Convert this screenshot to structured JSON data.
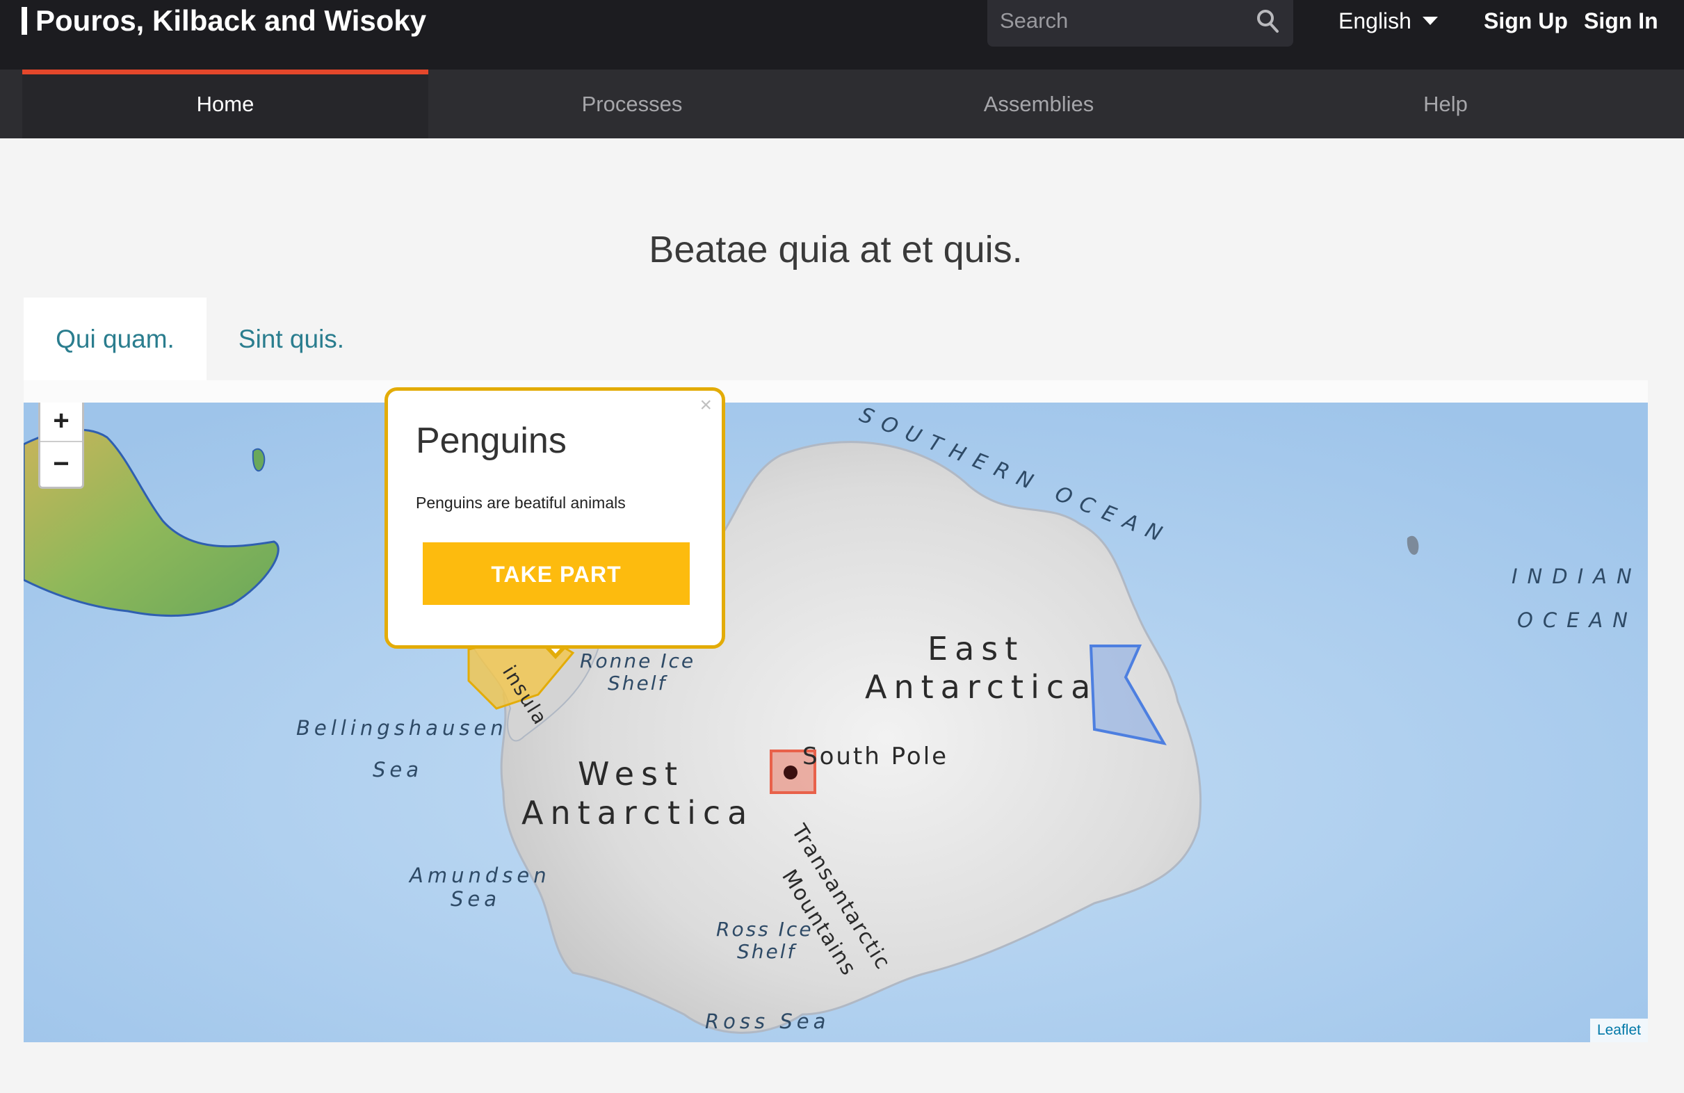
{
  "header": {
    "brand": "Pouros, Kilback and Wisoky",
    "search_placeholder": "Search",
    "language": "English",
    "sign_up": "Sign Up",
    "sign_in": "Sign In"
  },
  "nav": {
    "items": [
      {
        "label": "Home",
        "active": true
      },
      {
        "label": "Processes",
        "active": false
      },
      {
        "label": "Assemblies",
        "active": false
      },
      {
        "label": "Help",
        "active": false
      }
    ]
  },
  "main": {
    "title": "Beatae quia at et quis.",
    "tabs": [
      {
        "label": "Qui quam.",
        "active": true
      },
      {
        "label": "Sint quis.",
        "active": false
      }
    ]
  },
  "map": {
    "zoom_in": "+",
    "zoom_out": "−",
    "attribution": "Leaflet",
    "labels": {
      "southern_ocean": "SOUTHERN OCEAN",
      "indian": "INDIAN",
      "ocean": "OCEAN",
      "east": "East",
      "antarctica": "Antarctica",
      "west": "West",
      "south_pole": "South Pole",
      "ronne": "Ronne Ice",
      "shelf": "Shelf",
      "ross_ice": "Ross Ice",
      "bellingshausen": "Bellingshausen",
      "sea": "Sea",
      "amundsen": "Amundsen",
      "transantarctic": "Transantarctic",
      "mountains": "Mountains",
      "ross_sea": "Ross Sea",
      "peninsula": "insula"
    },
    "colors": {
      "water": "#a4c8ec",
      "land": "#e6e6e6",
      "highlight_area": "#f2c54a",
      "selected_square": "#e8614a",
      "blue_area": "#6d9be6"
    }
  },
  "popup": {
    "title": "Penguins",
    "text": "Penguins are beatiful animals",
    "button": "TAKE PART",
    "close": "×"
  },
  "colors": {
    "topbar": "#1c1c20",
    "navbar": "#2d2d31",
    "nav_active_indicator": "#e4472b",
    "tab_text": "#2a7d8e",
    "button": "#fdbb0e",
    "popup_border": "#e3ac08"
  }
}
